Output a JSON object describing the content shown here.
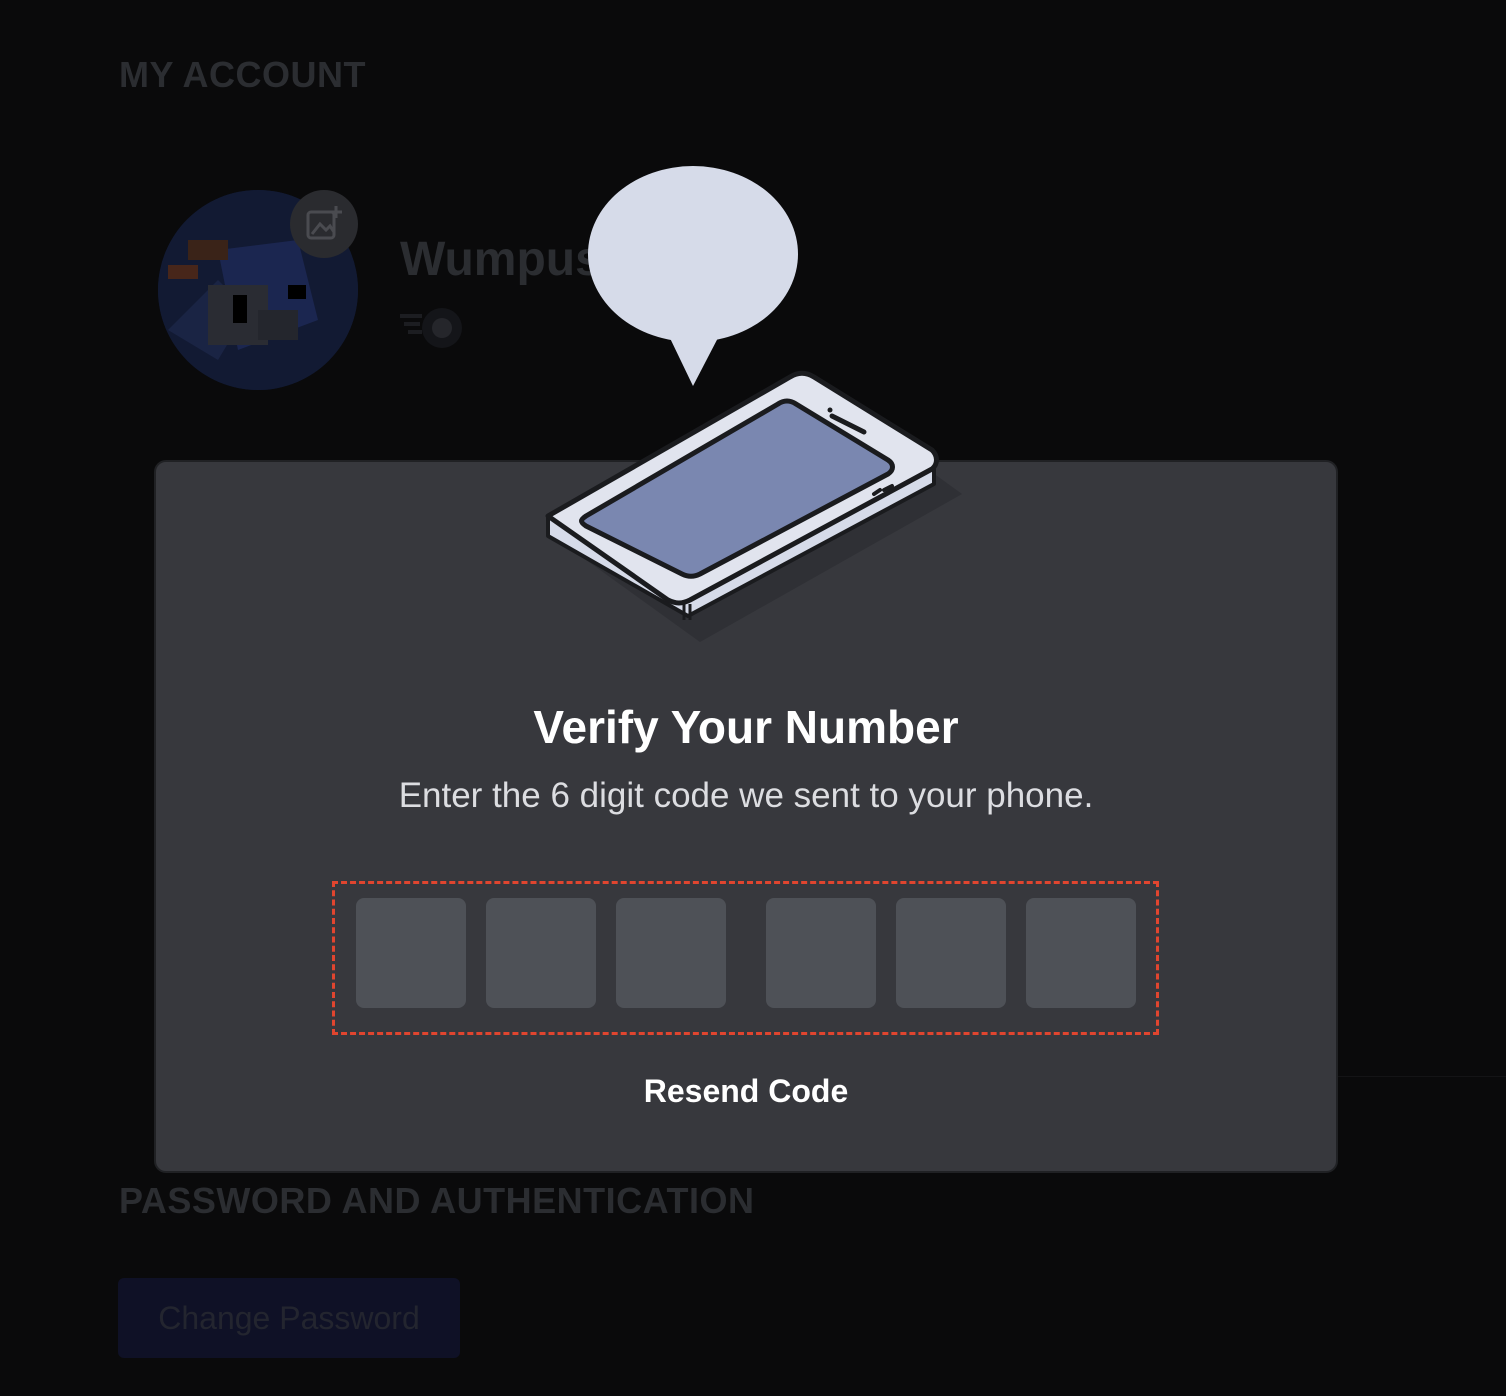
{
  "background": {
    "section_account": "MY ACCOUNT",
    "username": "Wumpus",
    "section_password": "PASSWORD AND AUTHENTICATION",
    "change_password_label": "Change Password"
  },
  "modal": {
    "title": "Verify Your Number",
    "subtitle": "Enter the 6 digit code we sent to your phone.",
    "code_digits": 6,
    "resend_label": "Resend Code",
    "illustration_icon": "phone-with-speech-bubble"
  },
  "colors": {
    "modal_background": "#37383d",
    "code_box": "#4e5157",
    "highlight_dashed_border": "#e0452f",
    "page_overlay": "#0a0a0b"
  }
}
